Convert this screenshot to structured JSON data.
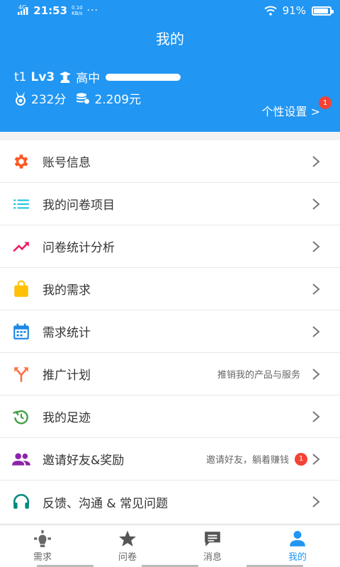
{
  "status": {
    "signal": "4G",
    "time": "21:53",
    "speed_top": "0.10",
    "speed_unit": "KB/s",
    "dots": "···",
    "battery": "91%",
    "battery_level": 0.91
  },
  "header": {
    "title": "我的"
  },
  "profile": {
    "uid": "t1",
    "level": "Lv3",
    "grade": "高中",
    "points": "232分",
    "balance": "2.209元",
    "settings_label": "个性设置 >",
    "settings_badge": "1"
  },
  "menu": [
    {
      "label": "账号信息",
      "icon": "gear-icon",
      "hint": "",
      "badge": ""
    },
    {
      "label": "我的问卷项目",
      "icon": "list-icon",
      "hint": "",
      "badge": ""
    },
    {
      "label": "问卷统计分析",
      "icon": "trend-icon",
      "hint": "",
      "badge": ""
    },
    {
      "label": "我的需求",
      "icon": "bag-icon",
      "hint": "",
      "badge": ""
    },
    {
      "label": "需求统计",
      "icon": "calendar-icon",
      "hint": "",
      "badge": ""
    },
    {
      "label": "推广计划",
      "icon": "split-arrows-icon",
      "hint": "推销我的产品与服务",
      "badge": ""
    },
    {
      "label": "我的足迹",
      "icon": "history-icon",
      "hint": "",
      "badge": ""
    },
    {
      "label": "邀请好友&奖励",
      "icon": "people-icon",
      "hint": "邀请好友，躺着赚钱",
      "badge": "1"
    },
    {
      "label": "反馈、沟通 & 常见问题",
      "icon": "headset-icon",
      "hint": "",
      "badge": ""
    }
  ],
  "tabs": [
    {
      "label": "需求",
      "icon": "lightbulb-icon",
      "active": false
    },
    {
      "label": "问卷",
      "icon": "star-icon",
      "active": false
    },
    {
      "label": "消息",
      "icon": "message-icon",
      "active": false
    },
    {
      "label": "我的",
      "icon": "person-icon",
      "active": true
    }
  ],
  "colors": {
    "primary": "#2196f3",
    "gear": "#ff5722",
    "list": "#26c6da",
    "trend": "#e91e63",
    "bag": "#ffc107",
    "calendar": "#1e88e5",
    "split": "#ff7043",
    "history": "#43a047",
    "people": "#8e24aa",
    "headset": "#00897b",
    "badge": "#f44336"
  }
}
